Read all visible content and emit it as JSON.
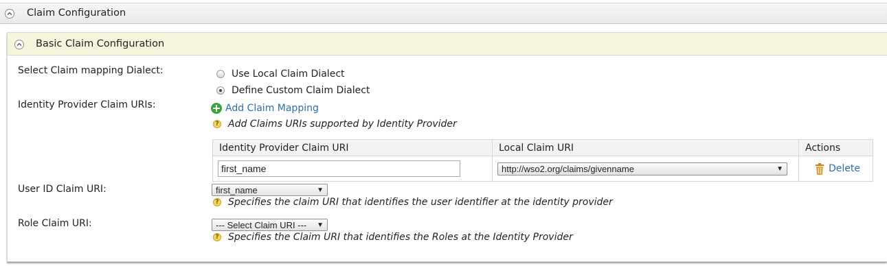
{
  "outer_section": {
    "title": "Claim Configuration"
  },
  "inner_section": {
    "title": "Basic Claim Configuration"
  },
  "dialect": {
    "label": "Select Claim mapping Dialect:",
    "options": [
      {
        "label": "Use Local Claim Dialect",
        "checked": false
      },
      {
        "label": "Define Custom Claim Dialect",
        "checked": true
      }
    ]
  },
  "idp_claims": {
    "label": "Identity Provider Claim URIs:",
    "add_link": "Add Claim Mapping",
    "help": "Add Claims URIs supported by Identity Provider"
  },
  "table": {
    "headers": [
      "Identity Provider Claim URI",
      "Local Claim URI",
      "Actions"
    ],
    "rows": [
      {
        "idp_claim": "first_name",
        "local_claim": "http://wso2.org/claims/givenname",
        "action": "Delete"
      }
    ]
  },
  "user_id": {
    "label": "User ID Claim URI:",
    "selected": "first_name",
    "help": "Specifies the claim URI that identifies the user identifier at the identity provider"
  },
  "role": {
    "label": "Role Claim URI:",
    "selected": "--- Select Claim URI ---",
    "help": "Specifies the Claim URI that identifies the Roles at the Identity Provider"
  },
  "icons": {
    "collapse": "chevron-up-icon",
    "add": "plus-circle-icon",
    "help": "question-icon",
    "delete": "trash-icon",
    "dropdown": "dropdown-arrow-icon"
  },
  "colors": {
    "link": "#2a6fb0",
    "inner_header_bg": "#f5f5dc",
    "add_icon": "#3aa43a",
    "help_icon": "#f4d35a",
    "trash_icon": "#e8a23a"
  }
}
